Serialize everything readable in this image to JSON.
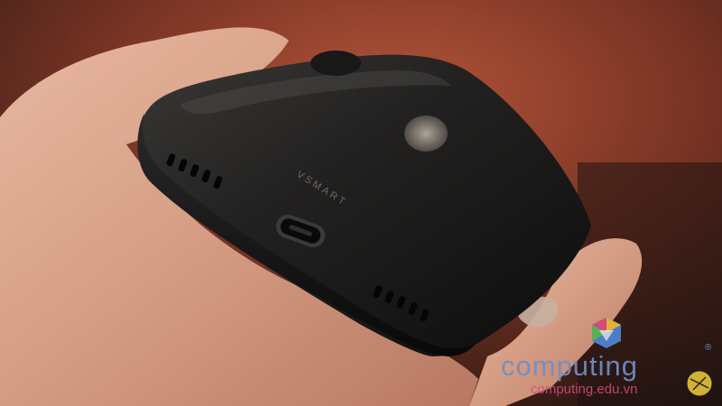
{
  "image": {
    "kind": "photo",
    "subject": "hand holding black smartphone showing bottom edge with USB-C port and speaker grilles"
  },
  "phone": {
    "back_logo_text": "VSMART"
  },
  "watermark": {
    "brand": "computing",
    "url": "computing.edu.vn",
    "registered_mark": "®"
  },
  "colors": {
    "background_warm": "#8a3d24",
    "background_dark": "#1e1310",
    "skin": "#d9a88f",
    "phone_body": "#1a1a1a",
    "watermark_blue": "#6f8fc8",
    "watermark_pink": "#d24a7a"
  }
}
